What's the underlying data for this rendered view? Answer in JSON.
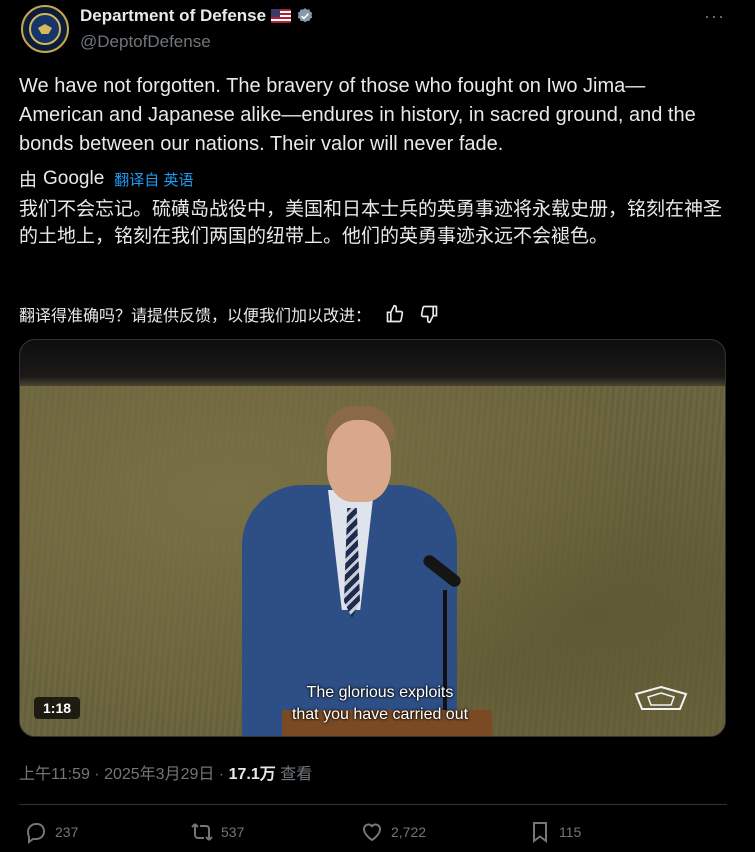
{
  "account": {
    "name": "Department of Defense",
    "handle": "@DeptofDefense",
    "more_label": "···"
  },
  "tweet": {
    "text_en": "We have not forgotten. The bravery of those who fought on Iwo Jima—American and Japanese alike—endures in history, in sacred ground, and the bonds between our nations. Their valor will never fade.",
    "by_label": "由",
    "google_label": "Google",
    "translated_from": "翻译自 英语",
    "text_zh": "我们不会忘记。硫磺岛战役中，美国和日本士兵的英勇事迹将永载史册，铭刻在神圣的土地上，铭刻在我们两国的纽带上。他们的英勇事迹永远不会褪色。",
    "feedback_prompt": "翻译得准确吗？请提供反馈，以便我们加以改进：",
    "thumbs_up_icon": "thumbs-up-icon",
    "thumbs_down_icon": "thumbs-down-icon"
  },
  "video": {
    "duration": "1:18",
    "caption_line1": "The glorious exploits",
    "caption_line2": "that you have carried out"
  },
  "meta": {
    "time": "上午11:59 · 2025年3月29日 · ",
    "views_count": "17.1万",
    "views_label": " 查看"
  },
  "actions": {
    "replies": "237",
    "retweets": "537",
    "likes": "2,722",
    "bookmarks": "115"
  },
  "colors": {
    "background": "#000000",
    "text": "#e7e9ea",
    "muted": "#71767b",
    "link": "#1d9bf0"
  }
}
